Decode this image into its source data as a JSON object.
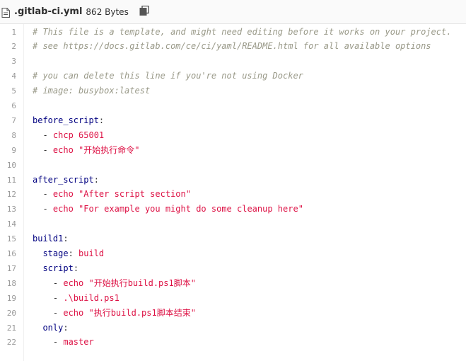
{
  "header": {
    "file_name": ".gitlab-ci.yml",
    "file_size": "862 Bytes"
  },
  "icons": {
    "file": "file-icon",
    "copy": "copy-icon"
  },
  "colors": {
    "comment": "#999988",
    "key": "#000080",
    "value": "#dd1144"
  },
  "code": {
    "lines": [
      {
        "n": "1",
        "indent": "",
        "comment": "# This file is a template, and might need editing before it works on your project."
      },
      {
        "n": "2",
        "indent": "",
        "comment": "# see https://docs.gitlab.com/ce/ci/yaml/README.html for all available options"
      },
      {
        "n": "3",
        "indent": ""
      },
      {
        "n": "4",
        "indent": "",
        "comment": "# you can delete this line if you're not using Docker"
      },
      {
        "n": "5",
        "indent": "",
        "comment": "# image: busybox:latest"
      },
      {
        "n": "6",
        "indent": ""
      },
      {
        "n": "7",
        "indent": "",
        "key": "before_script",
        "colon": ":"
      },
      {
        "n": "8",
        "indent": "  ",
        "dash": "- ",
        "value": "chcp 65001"
      },
      {
        "n": "9",
        "indent": "  ",
        "dash": "- ",
        "value": "echo \"开始执行命令\""
      },
      {
        "n": "10",
        "indent": ""
      },
      {
        "n": "11",
        "indent": "",
        "key": "after_script",
        "colon": ":"
      },
      {
        "n": "12",
        "indent": "  ",
        "dash": "- ",
        "value": "echo \"After script section\""
      },
      {
        "n": "13",
        "indent": "  ",
        "dash": "- ",
        "value": "echo \"For example you might do some cleanup here\""
      },
      {
        "n": "14",
        "indent": ""
      },
      {
        "n": "15",
        "indent": "",
        "key": "build1",
        "colon": ":"
      },
      {
        "n": "16",
        "indent": "  ",
        "key": "stage",
        "colon": ": ",
        "value": "build"
      },
      {
        "n": "17",
        "indent": "  ",
        "key": "script",
        "colon": ":"
      },
      {
        "n": "18",
        "indent": "    ",
        "dash": "- ",
        "value": "echo \"开始执行build.ps1脚本\""
      },
      {
        "n": "19",
        "indent": "    ",
        "dash": "- ",
        "value": ".\\build.ps1"
      },
      {
        "n": "20",
        "indent": "    ",
        "dash": "- ",
        "value": "echo \"执行build.ps1脚本结束\""
      },
      {
        "n": "21",
        "indent": "  ",
        "key": "only",
        "colon": ":"
      },
      {
        "n": "22",
        "indent": "    ",
        "dash": "- ",
        "value": "master"
      }
    ]
  }
}
